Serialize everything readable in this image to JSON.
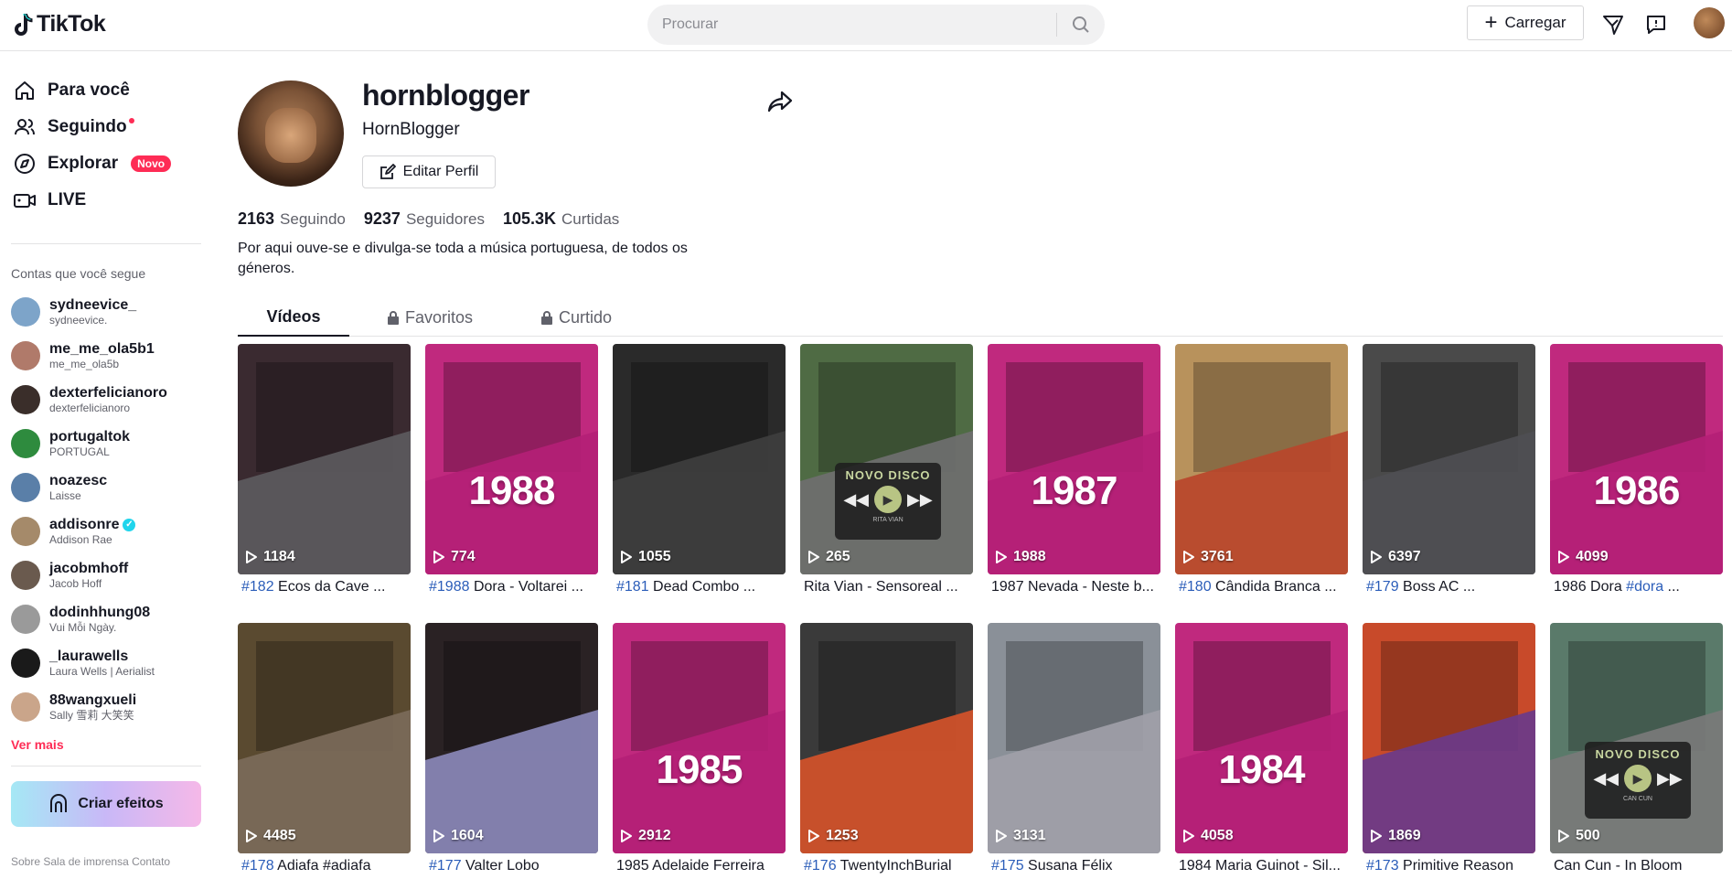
{
  "app": {
    "name": "TikTok"
  },
  "search": {
    "placeholder": "Procurar"
  },
  "header": {
    "upload_label": "Carregar"
  },
  "nav": [
    {
      "label": "Para você",
      "icon": "home-icon"
    },
    {
      "label": "Seguindo",
      "icon": "users-icon",
      "dot": true
    },
    {
      "label": "Explorar",
      "icon": "compass-icon",
      "badge": "Novo"
    },
    {
      "label": "LIVE",
      "icon": "live-icon"
    }
  ],
  "following": {
    "title": "Contas que você segue",
    "accounts": [
      {
        "name": "sydneevice_",
        "sub": "sydneevice.",
        "color": "#7da4c9"
      },
      {
        "name": "me_me_ola5b1",
        "sub": "me_me_ola5b",
        "color": "#b07a6a"
      },
      {
        "name": "dexterfelicianoro",
        "sub": "dexterfelicianoro",
        "color": "#3a2e2a"
      },
      {
        "name": "portugaltok",
        "sub": "PORTUGAL",
        "color": "#2e8b3e"
      },
      {
        "name": "noazesc",
        "sub": "Laisse",
        "color": "#5a7fa8"
      },
      {
        "name": "addisonre",
        "sub": "Addison  Rae",
        "color": "#a58a6a",
        "verified": true
      },
      {
        "name": "jacobmhoff",
        "sub": "Jacob Hoff",
        "color": "#6a5a4e"
      },
      {
        "name": "dodinhhung08",
        "sub": "Vui Mỗi Ngày.",
        "color": "#9a9a9a"
      },
      {
        "name": "_laurawells",
        "sub": "Laura Wells | Aerialist",
        "color": "#1a1a1a"
      },
      {
        "name": "88wangxueli",
        "sub": "Sally 雪莉 大笑笑",
        "color": "#caa58a"
      }
    ],
    "see_more": "Ver mais"
  },
  "effects": {
    "label": "Criar efeitos"
  },
  "footer": {
    "text": "Sobre  Sala de imprensa  Contato"
  },
  "profile": {
    "username": "hornblogger",
    "display_name": "HornBlogger",
    "edit_label": "Editar Perfil",
    "stats": [
      {
        "value": "2163",
        "label": "Seguindo"
      },
      {
        "value": "9237",
        "label": "Seguidores"
      },
      {
        "value": "105.3K",
        "label": "Curtidas"
      }
    ],
    "bio": "Por aqui ouve-se e divulga-se toda a música portuguesa, de todos os géneros."
  },
  "tabs": [
    {
      "label": "Vídeos",
      "active": true
    },
    {
      "label": "Favoritos",
      "locked": true
    },
    {
      "label": "Curtido",
      "locked": true
    }
  ],
  "videos": [
    {
      "views": "1184",
      "tag": "#182",
      "text": " Ecos da Cave ...",
      "year": "",
      "bg": "#3a2a30",
      "band": "#5c5a5e"
    },
    {
      "views": "774",
      "tag": "#1988",
      "text": " Dora - Voltarei ...",
      "year": "1988",
      "bg": "#c0297e",
      "band": "#b41f76"
    },
    {
      "views": "1055",
      "tag": "#181",
      "text": " Dead Combo ...",
      "year": "",
      "bg": "#2a2a2a",
      "band": "#3e3e3e"
    },
    {
      "views": "265",
      "tag": "",
      "text": "Rita Vian - Sensoreal ...",
      "year": "",
      "bg": "#4f6b44",
      "band": "#6f6f6f",
      "disc": "NOVO DISCO",
      "disc_sub": "RITA VIAN"
    },
    {
      "views": "1988",
      "tag": "",
      "text": "1987 Nevada - Neste b...",
      "year": "1987",
      "bg": "#c0297e",
      "band": "#b41f76"
    },
    {
      "views": "3761",
      "tag": "#180",
      "text": " Cândida Branca ...",
      "year": "",
      "bg": "#b8925c",
      "band": "#b8472b"
    },
    {
      "views": "6397",
      "tag": "#179",
      "text": " Boss AC ...",
      "year": "",
      "bg": "#4a4a4a",
      "band": "#4e4e52"
    },
    {
      "views": "4099",
      "tag": "#dora",
      "text": " ...",
      "prefix": "1986 Dora ",
      "year": "1986",
      "bg": "#c0297e",
      "band": "#b41f76"
    },
    {
      "views": "4485",
      "tag": "#178",
      "text": " Adiafa #adiafa",
      "year": "",
      "bg": "#5a4a30",
      "band": "#7b6a5a"
    },
    {
      "views": "1604",
      "tag": "#177",
      "text": " Valter Lobo",
      "year": "",
      "bg": "#2a2224",
      "band": "#8a88b8"
    },
    {
      "views": "2912",
      "tag": "",
      "text": "1985 Adelaide Ferreira",
      "year": "1985",
      "bg": "#c0297e",
      "band": "#b41f76"
    },
    {
      "views": "1253",
      "tag": "#176",
      "text": " TwentyInchBurial",
      "year": "",
      "bg": "#3a3a3a",
      "band": "#d4532a"
    },
    {
      "views": "3131",
      "tag": "#175",
      "text": " Susana Félix",
      "year": "",
      "bg": "#8a9098",
      "band": "#a0a0a8"
    },
    {
      "views": "4058",
      "tag": "",
      "text": "1984 Maria Guinot - Sil...",
      "year": "1984",
      "bg": "#c0297e",
      "band": "#b41f76"
    },
    {
      "views": "1869",
      "tag": "#173",
      "text": " Primitive Reason",
      "year": "",
      "bg": "#c84a2a",
      "band": "#6a3a8a"
    },
    {
      "views": "500",
      "tag": "",
      "text": "Can Cun - In Bloom",
      "year": "",
      "bg": "#5a7a6a",
      "band": "#7a7a7a",
      "disc": "NOVO DISCO",
      "disc_sub": "CAN CUN"
    }
  ]
}
